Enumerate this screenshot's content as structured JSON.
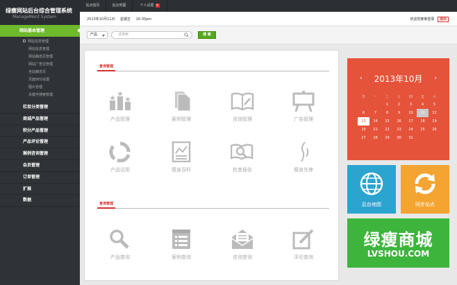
{
  "app": {
    "title": "绿瘦网站后台综合管理系统",
    "subtitle": "ManageMent System"
  },
  "tabs": [
    {
      "label": "站点首页"
    },
    {
      "label": "后台地图"
    },
    {
      "label": "个人设置",
      "close": "×"
    }
  ],
  "info": {
    "date": "2013年10月11日",
    "weekday": "星期五",
    "time": "16:30pm",
    "welcome": "欢迎您某某登录",
    "logout": "退出"
  },
  "search": {
    "category": "产品",
    "placeholder": "请搜索",
    "button": "搜 索"
  },
  "sidebar": {
    "active": "网站基本管理",
    "subitems": [
      {
        "label": "网站信息管理"
      },
      {
        "label": "网站信息管理"
      },
      {
        "label": "网站静态页管理"
      },
      {
        "label": "网站广告位管理"
      },
      {
        "label": "全站静态页"
      },
      {
        "label": "页面SEO设置"
      },
      {
        "label": "图片管理"
      },
      {
        "label": "关键字搜索管理"
      }
    ],
    "categories": [
      {
        "label": "栏目分类管理"
      },
      {
        "label": "商城产品管理"
      },
      {
        "label": "积分产品管理"
      },
      {
        "label": "产品评论管理"
      },
      {
        "label": "案例咨询管理"
      },
      {
        "label": "会员管理"
      },
      {
        "label": "订单管理"
      },
      {
        "label": "扩展"
      },
      {
        "label": "数据"
      }
    ]
  },
  "main": {
    "section1_title": "查询管理",
    "section1_tiles": [
      {
        "label": "产品管理",
        "icon": "podium-icon"
      },
      {
        "label": "案例管理",
        "icon": "documents-icon"
      },
      {
        "label": "咨询管理",
        "icon": "book-icon"
      },
      {
        "label": "广告管理",
        "icon": "billboard-icon"
      },
      {
        "label": "产品试用",
        "icon": "cycle-icon"
      },
      {
        "label": "瘦身百科",
        "icon": "report-icon"
      },
      {
        "label": "检查报告",
        "icon": "book-search-icon"
      },
      {
        "label": "瘦身先锋",
        "icon": "body-outline-icon"
      }
    ],
    "section2_title": "查询管理",
    "section2_tiles": [
      {
        "label": "产品查询",
        "icon": "magnifier-icon"
      },
      {
        "label": "案例查询",
        "icon": "list-icon"
      },
      {
        "label": "咨询查询",
        "icon": "envelope-icon"
      },
      {
        "label": "评论查询",
        "icon": "edit-icon"
      }
    ]
  },
  "calendar": {
    "title": "2013年10月",
    "prev": "‹",
    "next": "›",
    "weekdays": [
      "日",
      "一",
      "二",
      "三",
      "四",
      "五",
      "六"
    ],
    "weeks": [
      [
        "",
        "",
        "1",
        "2",
        "3",
        "4",
        "5"
      ],
      [
        "6",
        "7",
        "8",
        "9",
        "10",
        "11",
        "12"
      ],
      [
        "13",
        "14",
        "15",
        "16",
        "17",
        "18",
        "19"
      ],
      [
        "20",
        "21",
        "22",
        "23",
        "24",
        "25",
        "26"
      ],
      [
        "27",
        "28",
        "29",
        "30",
        "31",
        "",
        ""
      ]
    ],
    "highlighted_day": "11",
    "today_day": "13"
  },
  "quick_tiles": {
    "map_label": "后台地图",
    "sync_label": "同步站点"
  },
  "brand": {
    "name": "绿瘦商城",
    "domain": "LVSHOU.COM"
  },
  "colors": {
    "accent_green": "#6fb92c",
    "sidebar_bg": "#2f3337",
    "calendar_red": "#e5533a",
    "map_blue": "#2ba4cf",
    "sync_orange": "#f4a430",
    "brand_green": "#3db53c",
    "title_red": "#d2322d"
  }
}
